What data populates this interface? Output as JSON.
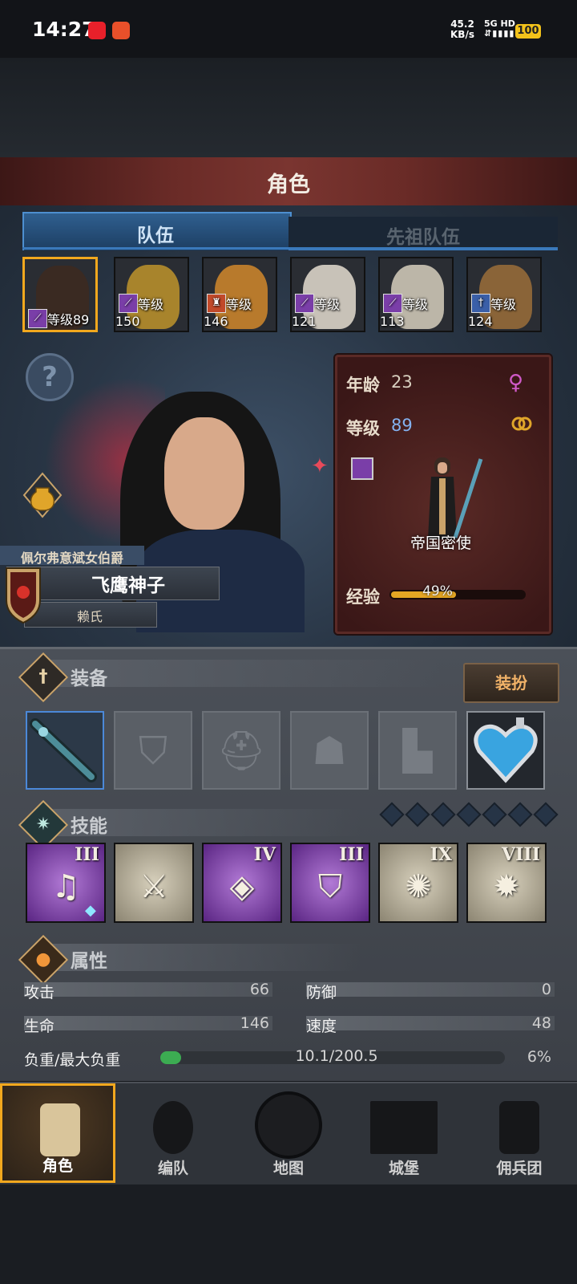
{
  "status_bar": {
    "time": "14:27",
    "net_speed_value": "45.2",
    "net_speed_unit": "KB/s",
    "network": "5G HD",
    "battery": "100"
  },
  "header": {
    "title": "角色"
  },
  "tabs": [
    {
      "label": "队伍",
      "active": true
    },
    {
      "label": "先祖队伍",
      "active": false
    }
  ],
  "party": [
    {
      "level_label": "等级89",
      "class_icon": "staff-icon",
      "face_color": "#3a2a22",
      "selected": true
    },
    {
      "level_label": "等级150",
      "class_icon": "staff-icon",
      "face_color": "#a8842c",
      "selected": false
    },
    {
      "level_label": "等级146",
      "class_icon": "castle-icon",
      "face_color": "#b87a2c",
      "selected": false
    },
    {
      "level_label": "等级121",
      "class_icon": "staff-icon",
      "face_color": "#c8c2b8",
      "selected": false
    },
    {
      "level_label": "等级113",
      "class_icon": "staff-icon",
      "face_color": "#bcb6a8",
      "selected": false
    },
    {
      "level_label": "等级124",
      "class_icon": "sword-icon",
      "face_color": "#8a6438",
      "selected": false
    }
  ],
  "character": {
    "noble_title": "佩尔弗意斌女伯爵",
    "name": "飞鹰神子",
    "surname": "赖氏",
    "age_label": "年龄",
    "age": "23",
    "level_label": "等级",
    "level": "89",
    "class_name": "帝国密使",
    "exp_label": "经验",
    "exp_text": "49%",
    "exp_fraction": 0.49,
    "gender_icon": "female-icon"
  },
  "equipment": {
    "title": "装备",
    "dress_button": "装扮",
    "slots": [
      {
        "name": "weapon-slot",
        "state": "filled",
        "icon": "staff-icon"
      },
      {
        "name": "shield-slot",
        "state": "empty",
        "icon": "shield-icon"
      },
      {
        "name": "helmet-slot",
        "state": "empty",
        "icon": "helmet-icon"
      },
      {
        "name": "armor-slot",
        "state": "empty",
        "icon": "armor-icon"
      },
      {
        "name": "boots-slot",
        "state": "empty",
        "icon": "boots-icon"
      },
      {
        "name": "amulet-slot",
        "state": "filled",
        "icon": "heart-amulet-icon"
      }
    ]
  },
  "skills": {
    "title": "技能",
    "gems_count": 7,
    "items": [
      {
        "rank": "III",
        "style": "purple",
        "icon": "music-note-icon"
      },
      {
        "rank": "",
        "style": "stone",
        "icon": "sword-summon-icon"
      },
      {
        "rank": "IV",
        "style": "purple",
        "icon": "crystal-hand-icon"
      },
      {
        "rank": "III",
        "style": "purple",
        "icon": "shield-icon"
      },
      {
        "rank": "IX",
        "style": "stone",
        "icon": "burst-icon"
      },
      {
        "rank": "VIII",
        "style": "stone",
        "icon": "explosion-icon"
      }
    ]
  },
  "attributes": {
    "title": "属性",
    "attack_label": "攻击",
    "attack": "66",
    "defense_label": "防御",
    "defense": "0",
    "hp_label": "生命",
    "hp": "146",
    "speed_label": "速度",
    "speed": "48",
    "load_label": "负重/最大负重",
    "load": "10.1/200.5",
    "load_percent": "6%",
    "load_fraction": 0.06
  },
  "nav": [
    {
      "label": "角色",
      "active": true,
      "icon": "knight-icon"
    },
    {
      "label": "编队",
      "active": false,
      "icon": "formation-icon"
    },
    {
      "label": "地图",
      "active": false,
      "icon": "compass-map-icon"
    },
    {
      "label": "城堡",
      "active": false,
      "icon": "castle-icon"
    },
    {
      "label": "佣兵团",
      "active": false,
      "icon": "mercenary-icon"
    }
  ],
  "colors": {
    "selection_gold": "#f2a81e",
    "tab_blue": "#3a79bb",
    "title_red": "#6a2b27",
    "exp_gold": "#e4a623",
    "load_green": "#3cac52",
    "class_purple": "#7a3ea8"
  }
}
